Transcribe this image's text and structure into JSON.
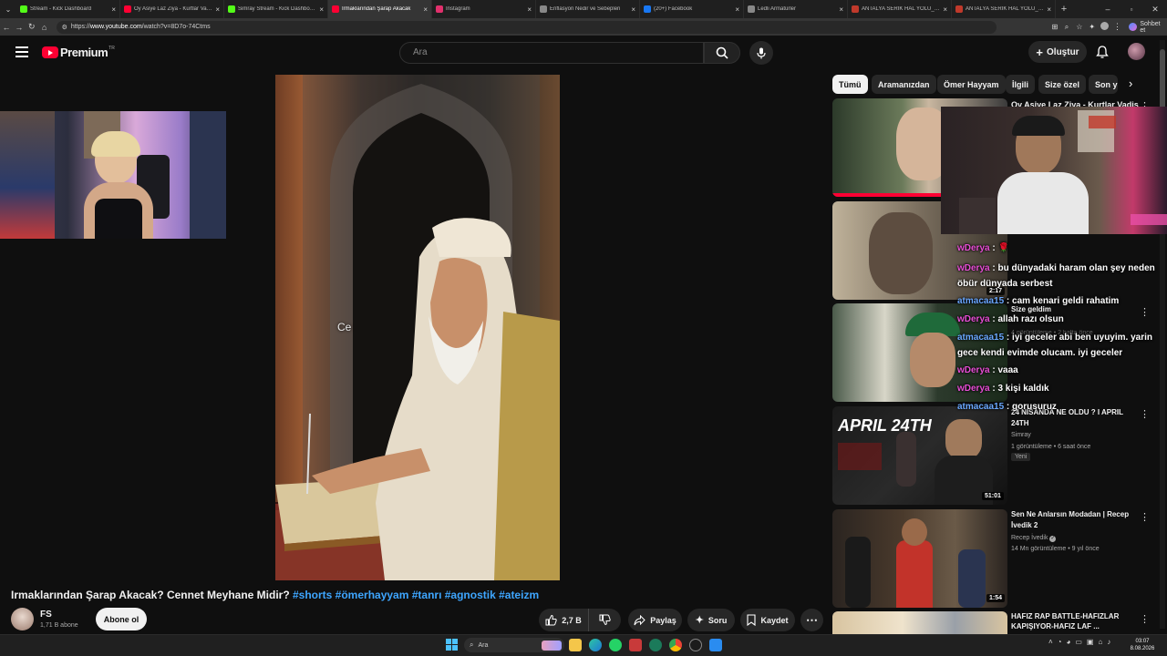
{
  "browser": {
    "tabs": [
      {
        "title": "Stream - Kick Dashboard",
        "color": "#53fc18"
      },
      {
        "title": "Oy Asiye Laz Ziya - Kurtlar Vadisi",
        "color": "#ff0033"
      },
      {
        "title": "Simray Stream - Kick Dashboard",
        "color": "#53fc18"
      },
      {
        "title": "Irmaklarından Şarap Akacak",
        "color": "#ff0033"
      },
      {
        "title": "Instagram",
        "color": "#e1306c"
      },
      {
        "title": "Enflasyon Nedir ve Sebepleri",
        "color": "#888888"
      },
      {
        "title": "(20+) Facebook",
        "color": "#1877f2"
      },
      {
        "title": "Ledli Armatürler",
        "color": "#888888"
      },
      {
        "title": "ANTALYA SERİK HAL YOLU_Rapo",
        "color": "#c0392b"
      },
      {
        "title": "ANTALYA SERİK HAL YOLU_Rapo",
        "color": "#c0392b"
      }
    ],
    "url_prefix": "https://",
    "url_host": "www.youtube.com",
    "url_path": "/watch?v=8D7o-74Ctms",
    "sohbet_label": "Sohbet et"
  },
  "youtube": {
    "logo_text": "Premium",
    "logo_sup": "TR",
    "search_placeholder": "Ara",
    "create_label": "Oluştur",
    "chips": [
      "Tümü",
      "Aramanızdan",
      "Ömer Hayyam",
      "İlgili",
      "Size özel",
      "Son y"
    ],
    "video": {
      "overlay_text": "Ce",
      "title_main": "Irmaklarından Şarap Akacak? Cennet Meyhane Midir?",
      "title_tags": "#shorts #ömerhayyam #tanrı #agnostik #ateizm",
      "channel": "FS",
      "subscribers": "1,71 B abone",
      "subscribe_label": "Abone ol",
      "likes": "2,7 B",
      "share_label": "Paylaş",
      "ask_label": "Soru",
      "save_label": "Kaydet"
    },
    "sidebar": [
      {
        "title": "Oy Asiye Laz Ziya - Kurtlar Vadisi",
        "channel": "",
        "meta": "",
        "duration": "",
        "badge": ""
      },
      {
        "title": "",
        "channel": "",
        "meta": "",
        "duration": "2:17",
        "badge": ""
      },
      {
        "title": "Size geldim",
        "channel": "",
        "meta": "4 görüntüleme • 2 hafta önce",
        "duration": "",
        "badge": ""
      },
      {
        "title": "24 NİSANDA NE OLDU ? I APRIL 24TH",
        "channel": "Simray",
        "meta": "1 görüntüleme • 6 saat önce",
        "duration": "51:01",
        "badge": "Yeni",
        "thumb_text": "APRIL 24TH"
      },
      {
        "title": "Sen Ne Anlarsın Modadan | Recep İvedik 2",
        "channel": "Recep İvedik",
        "meta": "14 Mn görüntüleme • 9 yıl önce",
        "duration": "1:54",
        "badge": ""
      },
      {
        "title": "HAFIZ RAP BATTLE-HAFIZLAR KAPIŞIYOR-HAFIZ LAF ...",
        "channel": "",
        "meta": "",
        "duration": "",
        "badge": ""
      }
    ]
  },
  "chat": [
    {
      "user": "wDerya",
      "sep": " : ",
      "msg": "🌹",
      "color": "u1"
    },
    {
      "user": "wDerya",
      "sep": " : ",
      "msg": "bu dünyadaki haram olan şey neden öbür dünyada serbest",
      "color": "u1"
    },
    {
      "user": "atmacaa15",
      "sep": " : ",
      "msg": "cam kenari geldi rahatim",
      "color": "u2"
    },
    {
      "user": "wDerya",
      "sep": " : ",
      "msg": "allah razı olsun",
      "color": "u1"
    },
    {
      "user": "atmacaa15",
      "sep": " : ",
      "msg": "iyi geceler abi ben uyuyim. yarin gece kendi evimde olucam. iyi geceler",
      "color": "u2"
    },
    {
      "user": "wDerya",
      "sep": " : ",
      "msg": "vaaa",
      "color": "u1"
    },
    {
      "user": "wDerya",
      "sep": " : ",
      "msg": "3 kişi kaldık",
      "color": "u1"
    },
    {
      "user": "atmacaa15",
      "sep": " : ",
      "msg": "gorusuruz",
      "color": "u2"
    }
  ],
  "taskbar": {
    "search_label": "Ara",
    "time": "03:07",
    "date": "8.08.2026"
  }
}
